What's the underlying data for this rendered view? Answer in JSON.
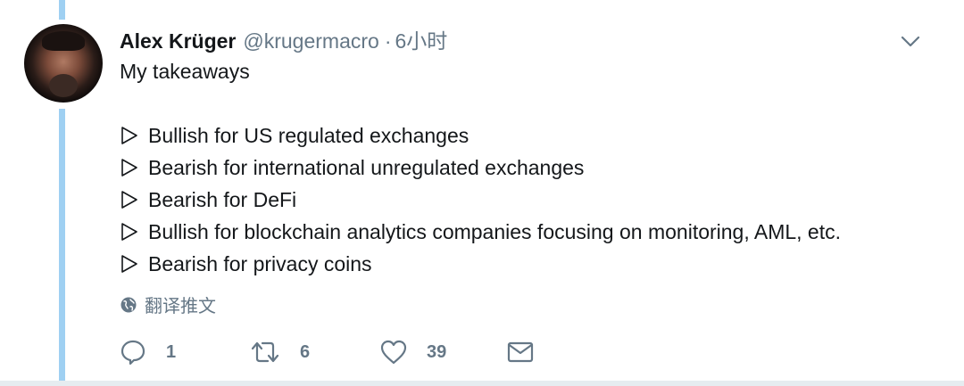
{
  "tweet": {
    "display_name": "Alex Krüger",
    "handle": "@krugermacro",
    "separator": "·",
    "time": "6小时",
    "first_line": "My takeaways",
    "bullets": [
      "Bullish for US regulated exchanges",
      "Bearish for international unregulated exchanges",
      "Bearish for DeFi",
      "Bullish for blockchain analytics companies focusing on monitoring, AML, etc.",
      "Bearish for privacy coins"
    ],
    "translate_label": "翻译推文",
    "actions": {
      "reply_count": "1",
      "retweet_count": "6",
      "like_count": "39"
    }
  },
  "colors": {
    "thread_line": "#9fd0f2",
    "secondary_text": "#657786",
    "primary_text": "#14171a"
  },
  "icons": [
    "avatar",
    "chevron-down-icon",
    "triangle-bullet-icon",
    "globe-icon",
    "reply-icon",
    "retweet-icon",
    "heart-icon",
    "message-icon"
  ]
}
